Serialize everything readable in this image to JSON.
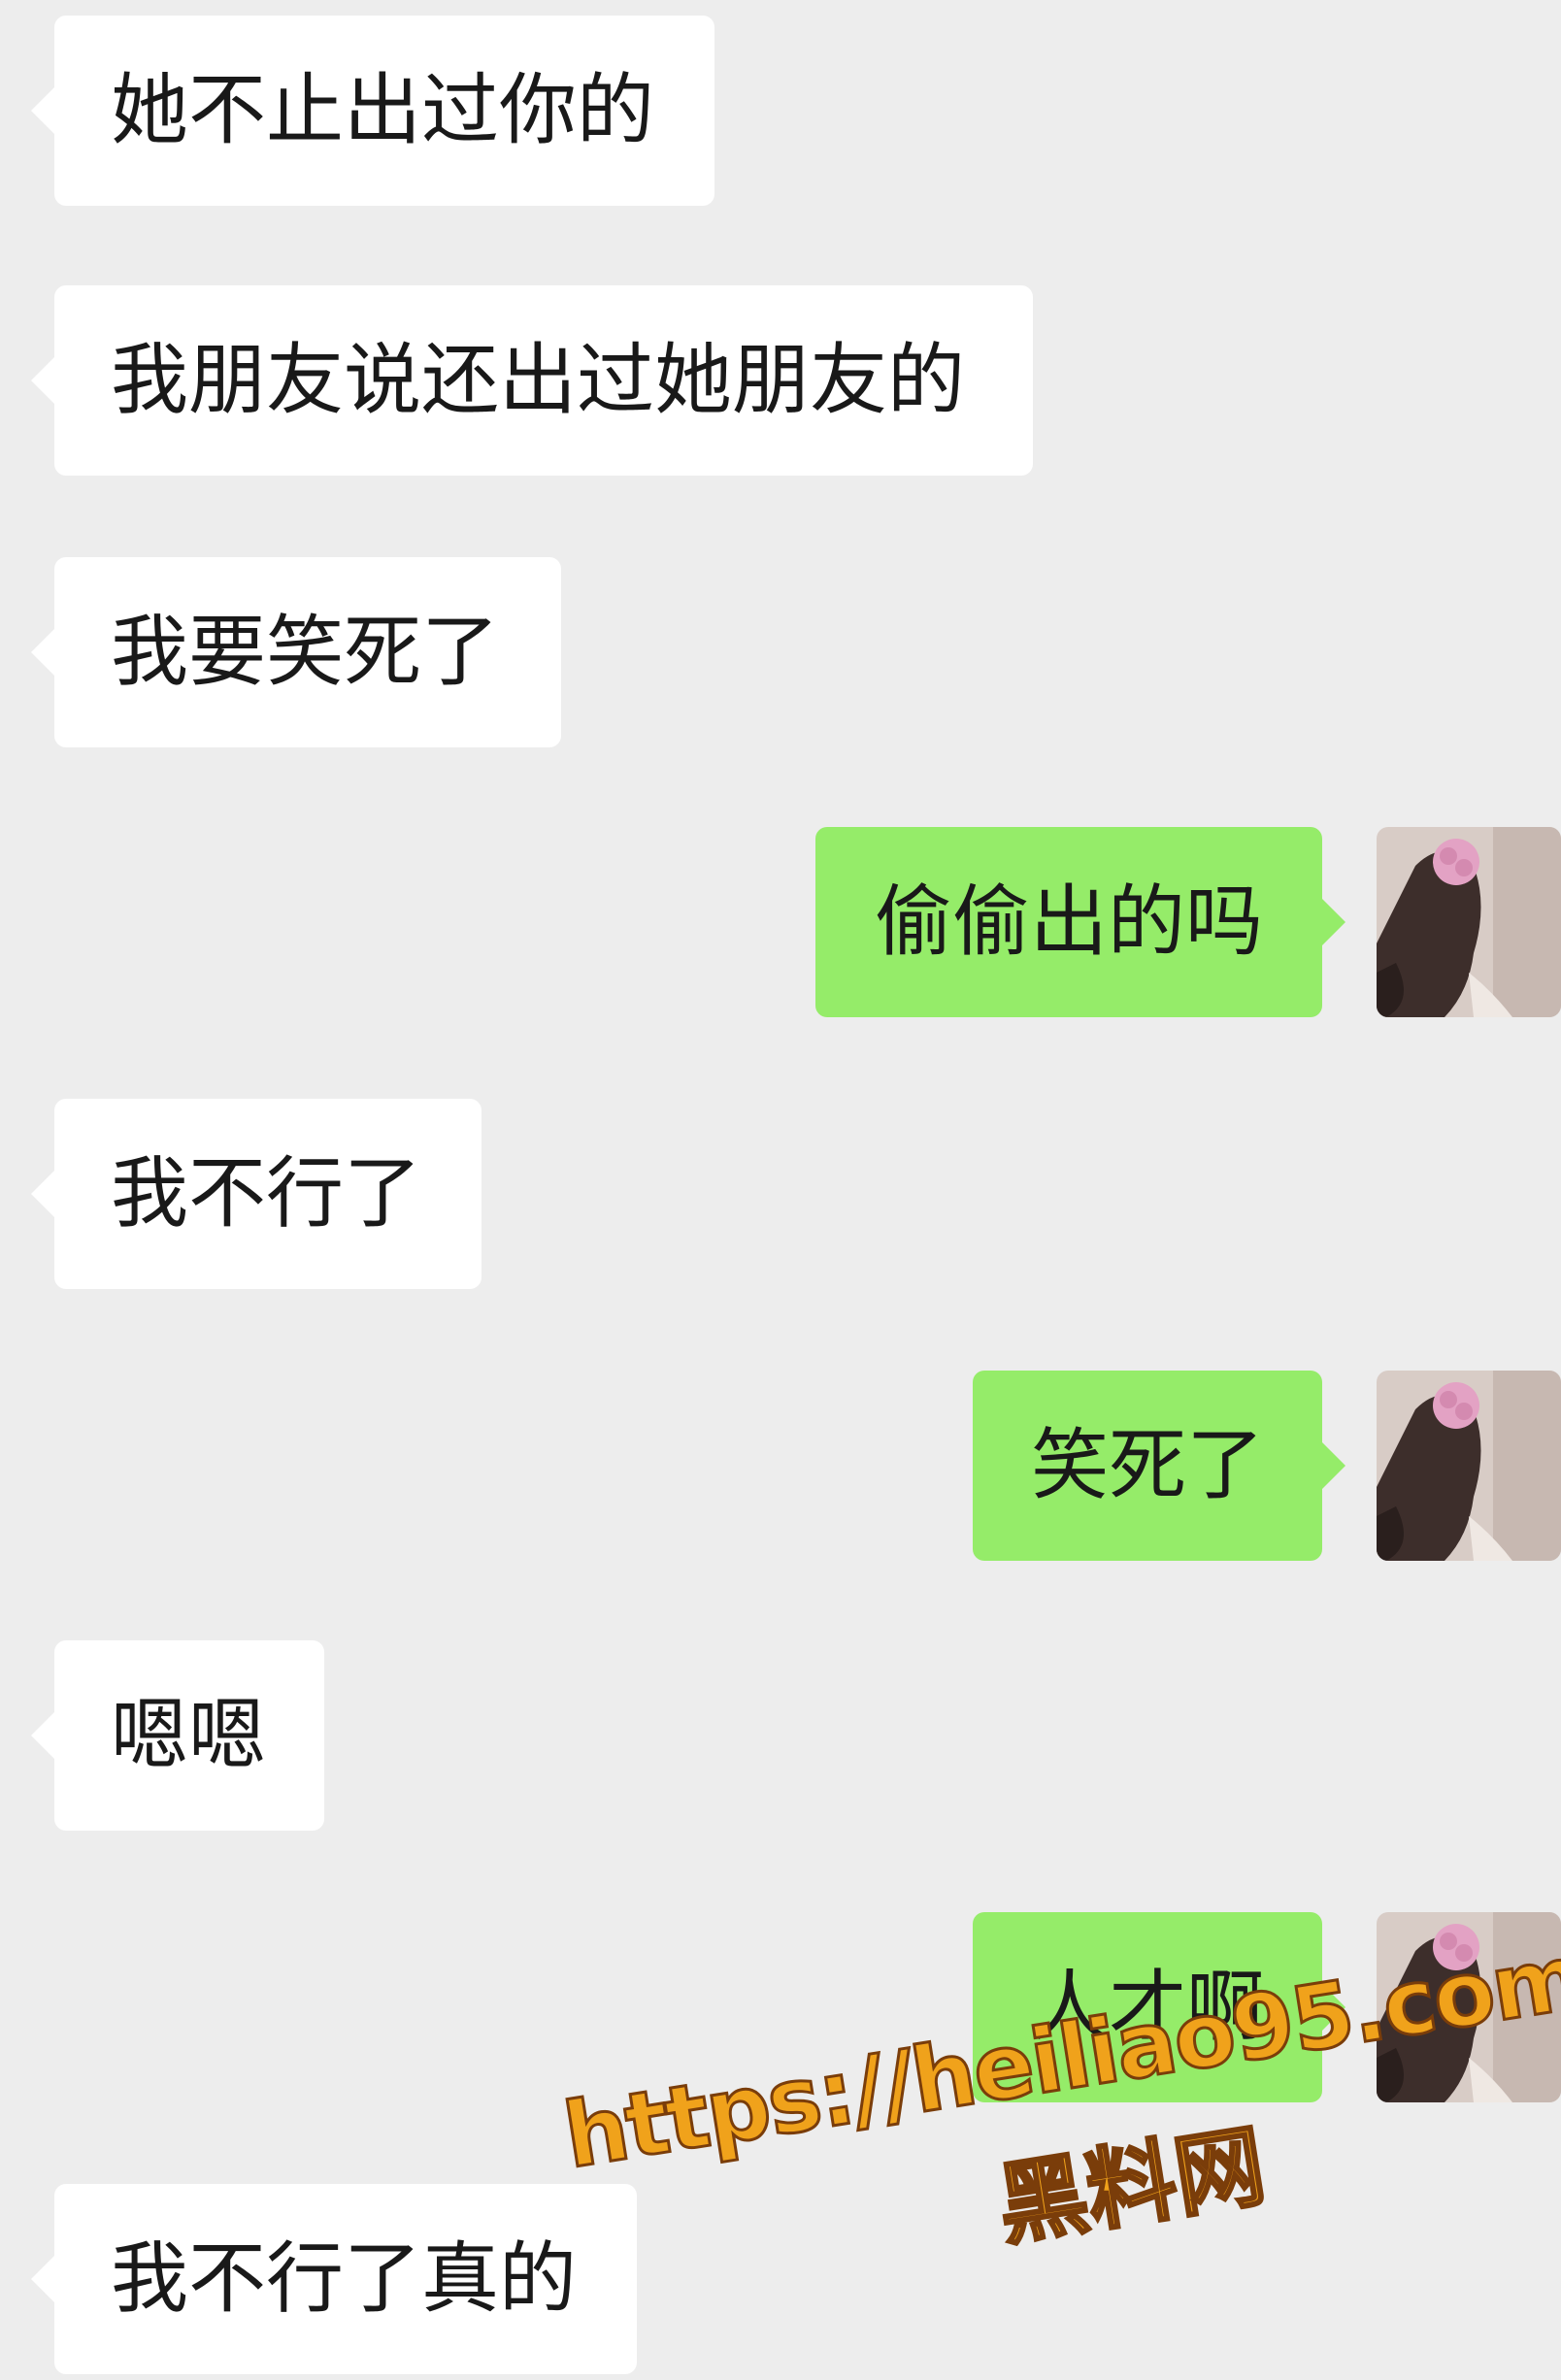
{
  "conversation": {
    "messages": [
      {
        "side": "left",
        "text": "她不止出过你的"
      },
      {
        "side": "left",
        "text": "我朋友说还出过她朋友的"
      },
      {
        "side": "left",
        "text": "我要笑死了"
      },
      {
        "side": "right",
        "text": "偷偷出的吗"
      },
      {
        "side": "left",
        "text": "我不行了"
      },
      {
        "side": "right",
        "text": "笑死了"
      },
      {
        "side": "left",
        "text": "嗯嗯"
      },
      {
        "side": "right",
        "text": "人才啊"
      },
      {
        "side": "left",
        "text": "我不行了真的"
      }
    ]
  },
  "watermark": {
    "url": "https://heiliao95.com",
    "name": "黑料网"
  },
  "colors": {
    "background": "#ededed",
    "incoming_bubble": "#ffffff",
    "outgoing_bubble": "#95ec69",
    "text": "#191919",
    "watermark_fill": "#f0a21b",
    "watermark_stroke": "#7a3d0a"
  },
  "icons": {
    "avatar": "user-avatar-photo-icon"
  }
}
